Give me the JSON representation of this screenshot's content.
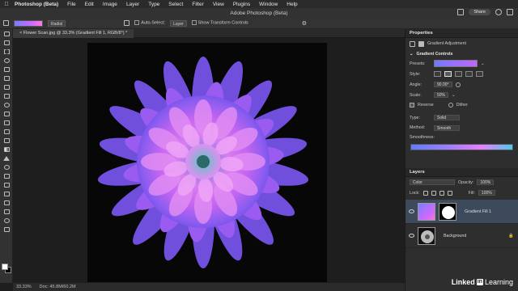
{
  "menubar": {
    "app": "Photoshop (Beta)",
    "items": [
      "File",
      "Edit",
      "Image",
      "Layer",
      "Type",
      "Select",
      "Filter",
      "View",
      "Plugins",
      "Window",
      "Help"
    ]
  },
  "titlebar": {
    "title": "Adobe Photoshop (Beta)",
    "share_label": "Share"
  },
  "options": {
    "gradient_type": "Radial",
    "auto_select_label": "Auto-Select:",
    "auto_select_value": "Layer",
    "show_transform_label": "Show Transform Controls"
  },
  "document": {
    "tab_label": "× Flower Scan.jpg @ 33.3% (Gradient Fill 1, RGB/8*) *"
  },
  "status": {
    "zoom": "33.33%",
    "doc_info": "Doc: 45.8M/60.2M"
  },
  "properties": {
    "panel_title": "Properties",
    "adjustment_label": "Gradient Adjustment",
    "section_title": "Gradient Controls",
    "presets_label": "Presets:",
    "style_label": "Style:",
    "angle_label": "Angle:",
    "angle_value": "90.00°",
    "scale_label": "Scale:",
    "scale_value": "50%",
    "reverse_label": "Reverse",
    "dither_label": "Dither",
    "type_label": "Type:",
    "type_value": "Solid",
    "method_label": "Method:",
    "method_value": "Smooth",
    "smoothness_label": "Smoothness:"
  },
  "layers": {
    "panel_title": "Layers",
    "blend_mode": "Color",
    "opacity_label": "Opacity:",
    "opacity_value": "100%",
    "lock_label": "Lock:",
    "fill_label": "Fill:",
    "fill_value": "100%",
    "items": [
      {
        "name": "Gradient Fill 1"
      },
      {
        "name": "Background"
      }
    ]
  },
  "branding": {
    "text": "Linked",
    "in": "in",
    "suffix": "Learning"
  },
  "colors": {
    "accent": "#3d4a5c",
    "gradient_start": "#6f7aff",
    "gradient_end": "#c565ff"
  }
}
